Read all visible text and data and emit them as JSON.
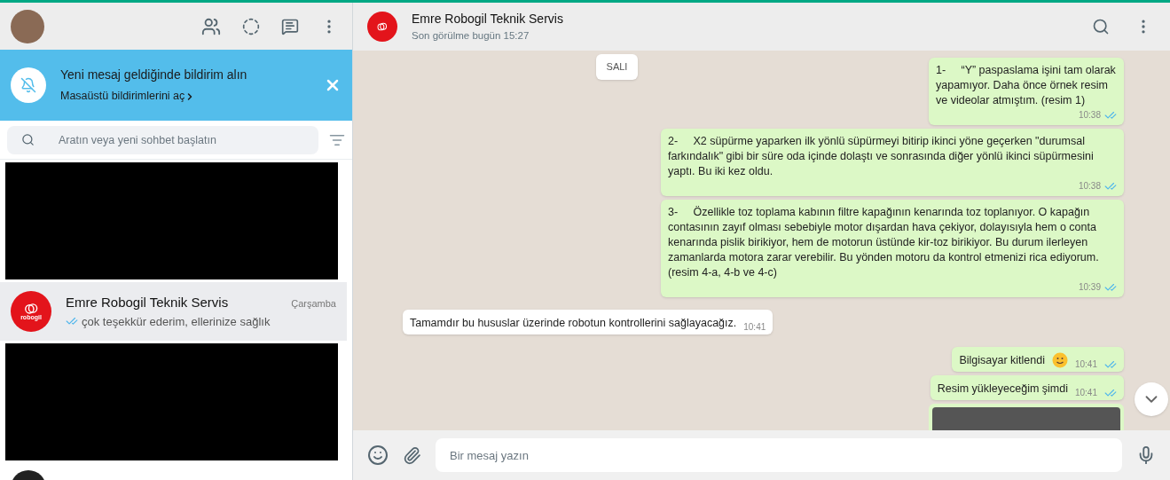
{
  "notification": {
    "title": "Yeni mesaj geldiğinde bildirim alın",
    "link": "Masaüstü bildirimlerini aç"
  },
  "search": {
    "placeholder": "Aratın veya yeni sohbet başlatın"
  },
  "chats": [
    {
      "kind": "redacted"
    },
    {
      "kind": "chat",
      "name": "Emre Robogil Teknik Servis",
      "time": "Çarşamba",
      "preview": "çok teşekkür ederim, ellerinize sağlık",
      "read": true,
      "selected": true
    },
    {
      "kind": "redacted"
    },
    {
      "kind": "partial"
    }
  ],
  "conversation": {
    "name": "Emre Robogil Teknik Servis",
    "status": "Son görülme bugün 15:27",
    "logo_text": "robogil"
  },
  "messages": [
    {
      "kind": "date",
      "text": "SALI"
    },
    {
      "kind": "out",
      "text": "1-     “Y” paspaslama işini tam olarak yapamıyor. Daha önce örnek resim ve videolar atmıştım. (resim 1)",
      "time": "10:38",
      "read": true
    },
    {
      "kind": "out",
      "text": "2-     X2 süpürme yaparken ilk yönlü süpürmeyi bitirip ikinci yöne geçerken \"durumsal farkındalık\" gibi bir süre oda içinde dolaştı ve sonrasında diğer yönlü ikinci süpürmesini yaptı. Bu iki kez oldu.",
      "time": "10:38",
      "read": true
    },
    {
      "kind": "out",
      "text": "3-     Özellikle toz toplama kabının filtre kapağının kenarında toz toplanıyor. O kapağın contasının zayıf olması sebebiyle motor dışardan hava çekiyor, dolayısıyla hem o conta kenarında pislik birikiyor, hem de motorun üstünde kir-toz birikiyor. Bu durum ilerleyen zamanlarda motora zarar verebilir. Bu yönden motoru da kontrol etmenizi rica ediyorum. (resim 4-a, 4-b ve 4-c)",
      "time": "10:39",
      "read": true
    },
    {
      "kind": "in",
      "text": "Tamamdır bu hususlar üzerinde robotun kontrollerini sağlayacağız.",
      "time": "10:41"
    },
    {
      "kind": "out",
      "text": "Bilgisayar kitlendi",
      "time": "10:41",
      "read": true,
      "emoji": true
    },
    {
      "kind": "out",
      "text": "Resim yükleyeceğim şimdi",
      "time": "10:41",
      "read": true
    },
    {
      "kind": "image"
    }
  ],
  "composer": {
    "placeholder": "Bir mesaj yazın"
  }
}
